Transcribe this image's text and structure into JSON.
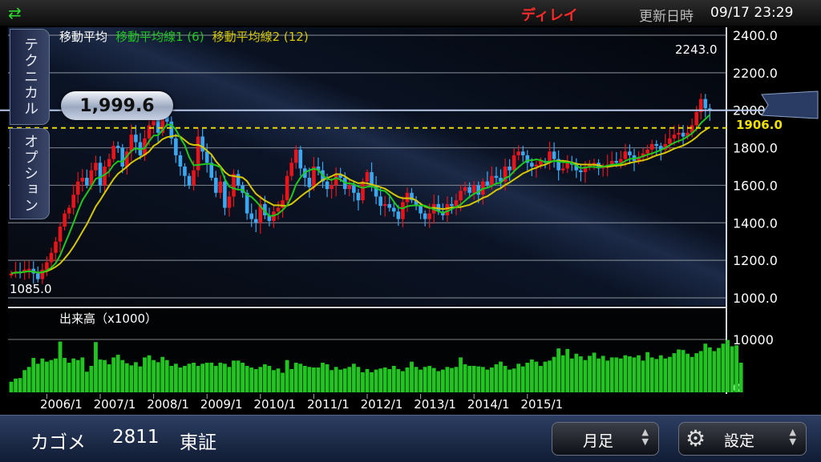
{
  "header": {
    "swap_icon": "swap-arrows-icon",
    "delay_label": "ディレイ",
    "update_label": "更新日時",
    "update_time": "09/17 23:29"
  },
  "tabs": {
    "technical": "テクニカル",
    "option": "オプション"
  },
  "indicator_legend": {
    "title": "移動平均",
    "ma1": "移動平均線1 (6)",
    "ma2": "移動平均線2 (12)"
  },
  "current_price": "1,999.6",
  "ref_line_price": "1906.0",
  "high_label": "2243.0",
  "low_label": "1085.0",
  "volume_label": "出来高（x1000）",
  "colors": {
    "up": "#e8141a",
    "down": "#3aa8f0",
    "ma1": "#1ec81e",
    "ma2": "#d6c800",
    "volume": "#22c422",
    "ref_line": "#e8d800"
  },
  "footer": {
    "name": "カゴメ",
    "code": "2811",
    "market": "東証",
    "period": "月足",
    "settings": "設定",
    "gear_icon": "gear-icon"
  },
  "chart_data": {
    "type": "candlestick",
    "price_axis": {
      "ticks": [
        "2400.0",
        "2200.0",
        "2000.0",
        "1800.0",
        "1600.0",
        "1400.0",
        "1200.0",
        "1000.0"
      ],
      "range": [
        1000,
        2400
      ]
    },
    "volume_axis": {
      "ticks": [
        "10000",
        "0"
      ],
      "range": [
        0,
        11500
      ]
    },
    "x_ticks": [
      "2006/1",
      "2007/1",
      "2008/1",
      "2009/1",
      "2010/1",
      "2011/1",
      "2012/1",
      "2013/1",
      "2014/1",
      "2015/1"
    ],
    "start": "2005/5",
    "closes": [
      1130,
      1140,
      1135,
      1150,
      1155,
      1130,
      1100,
      1150,
      1190,
      1240,
      1300,
      1380,
      1450,
      1480,
      1550,
      1620,
      1640,
      1600,
      1680,
      1720,
      1600,
      1700,
      1740,
      1810,
      1800,
      1700,
      1780,
      1870,
      1830,
      1760,
      1850,
      1920,
      1960,
      1880,
      1990,
      1940,
      1850,
      1760,
      1700,
      1650,
      1600,
      1680,
      1860,
      1780,
      1720,
      1640,
      1560,
      1620,
      1480,
      1540,
      1660,
      1600,
      1560,
      1450,
      1420,
      1400,
      1500,
      1440,
      1410,
      1460,
      1480,
      1520,
      1650,
      1720,
      1790,
      1690,
      1640,
      1590,
      1700,
      1680,
      1620,
      1580,
      1600,
      1660,
      1640,
      1580,
      1600,
      1560,
      1520,
      1620,
      1670,
      1600,
      1540,
      1490,
      1500,
      1480,
      1460,
      1420,
      1510,
      1560,
      1520,
      1490,
      1450,
      1420,
      1450,
      1500,
      1460,
      1440,
      1500,
      1490,
      1520,
      1570,
      1590,
      1560,
      1600,
      1550,
      1620,
      1600,
      1650,
      1640,
      1620,
      1700,
      1680,
      1760,
      1780,
      1760,
      1720,
      1700,
      1710,
      1730,
      1720,
      1780,
      1740,
      1680,
      1690,
      1720,
      1710,
      1680,
      1670,
      1700,
      1710,
      1720,
      1690,
      1700,
      1710,
      1730,
      1720,
      1740,
      1780,
      1760,
      1730,
      1750,
      1770,
      1790,
      1820,
      1810,
      1790,
      1820,
      1850,
      1870,
      1880,
      1860,
      1880,
      1920,
      1990,
      2060,
      2010,
      1999.6
    ],
    "volumes": [
      2000,
      2600,
      2700,
      4200,
      4800,
      6500,
      5400,
      6400,
      5800,
      6100,
      6400,
      9600,
      6500,
      5600,
      6400,
      6100,
      6600,
      3900,
      5000,
      9500,
      6200,
      6100,
      5300,
      6600,
      7100,
      6100,
      5500,
      5100,
      5700,
      4900,
      6600,
      7000,
      6100,
      5700,
      6700,
      6100,
      5000,
      5400,
      4700,
      5000,
      5400,
      5600,
      5000,
      5400,
      5600,
      5600,
      5000,
      5600,
      5400,
      4800,
      6000,
      6000,
      5600,
      5000,
      4700,
      4400,
      4800,
      5300,
      5000,
      4200,
      4500,
      3700,
      6100,
      4400,
      5600,
      5400,
      5000,
      4800,
      4700,
      4700,
      5600,
      5300,
      4200,
      4800,
      4300,
      4500,
      4800,
      5400,
      4800,
      3800,
      4400,
      3800,
      4300,
      4500,
      4700,
      4400,
      5000,
      4400,
      4000,
      4700,
      5800,
      4800,
      4300,
      4800,
      5000,
      4600,
      4000,
      4300,
      4800,
      4600,
      4800,
      6600,
      5300,
      5000,
      5000,
      4900,
      4800,
      4300,
      4700,
      5300,
      5800,
      5000,
      4300,
      4500,
      5400,
      4900,
      5600,
      6200,
      5800,
      5000,
      5800,
      6000,
      6700,
      8300,
      7000,
      8200,
      6400,
      7300,
      6800,
      6100,
      6900,
      7500,
      6400,
      6900,
      6000,
      6600,
      6600,
      6400,
      7000,
      6800,
      6600,
      7000,
      6000,
      7600,
      6600,
      6300,
      7000,
      6400,
      6700,
      7400,
      8100,
      8000,
      7300,
      6700,
      7400,
      7800,
      9200,
      8500,
      7800,
      8400,
      9200,
      9900,
      8700,
      8900,
      5600
    ]
  }
}
